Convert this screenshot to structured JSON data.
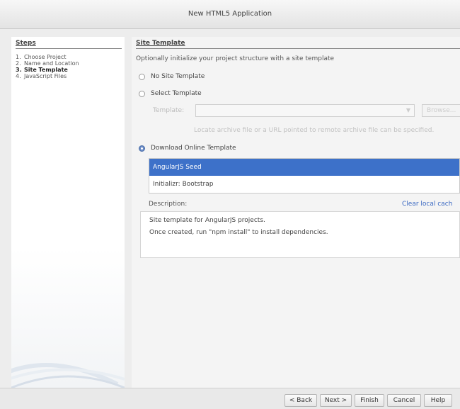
{
  "window": {
    "title": "New HTML5 Application"
  },
  "steps": {
    "heading": "Steps",
    "items": [
      {
        "num": "1.",
        "label": "Choose Project"
      },
      {
        "num": "2.",
        "label": "Name and Location"
      },
      {
        "num": "3.",
        "label": "Site Template"
      },
      {
        "num": "4.",
        "label": "JavaScript Files"
      }
    ]
  },
  "site_template": {
    "title": "Site Template",
    "intro": "Optionally initialize your project structure with a site template",
    "options": {
      "no_template": "No Site Template",
      "select_template": "Select Template",
      "download_online": "Download Online Template"
    },
    "selected_option": "download_online",
    "template_label": "Template:",
    "template_value": "",
    "browse_label": "Browse...",
    "hint": "Locate archive file or a URL pointed to remote archive file can be specified.",
    "online_templates": [
      "AngularJS Seed",
      "Initializr: Bootstrap"
    ],
    "selected_template": "AngularJS Seed",
    "description_label": "Description:",
    "clear_cache_label": "Clear local cach",
    "description_lines": [
      "Site template for AngularJS projects.",
      "Once created, run \"npm install\" to install dependencies."
    ]
  },
  "footer": {
    "back": "< Back",
    "next": "Next >",
    "finish": "Finish",
    "cancel": "Cancel",
    "help": "Help"
  },
  "colors": {
    "selection": "#3d71c9",
    "link": "#3a68c2",
    "dialog_bg": "#ededed"
  }
}
